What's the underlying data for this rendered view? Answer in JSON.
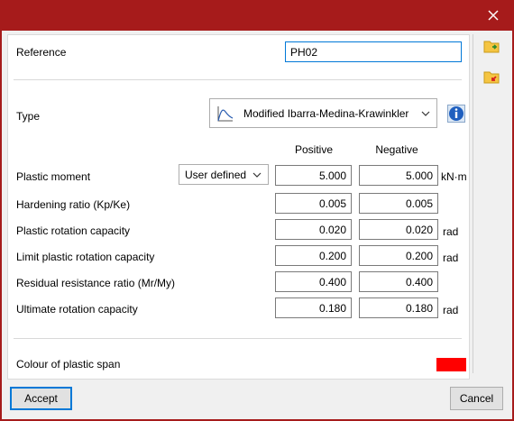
{
  "colors": {
    "titlebar": "#a61b1b",
    "accent": "#0078d7",
    "plastic_span_colour": "#ff0000"
  },
  "icons": {
    "close": "close-icon",
    "folder_open": "folder-open-icon",
    "folder_save": "folder-save-icon",
    "curve": "curve-icon",
    "info": "info-icon",
    "chevron": "chevron-down-icon"
  },
  "reference": {
    "label": "Reference",
    "value": "PH02"
  },
  "type": {
    "label": "Type",
    "selected": "Modified Ibarra-Medina-Krawinkler"
  },
  "columns": {
    "positive": "Positive",
    "negative": "Negative"
  },
  "rows": [
    {
      "label": "Plastic moment",
      "mode": "User defined",
      "positive": "5.000",
      "negative": "5.000",
      "unit": "kN·m"
    },
    {
      "label": "Hardening ratio (Kp/Ke)",
      "positive": "0.005",
      "negative": "0.005",
      "unit": ""
    },
    {
      "label": "Plastic rotation capacity",
      "positive": "0.020",
      "negative": "0.020",
      "unit": "rad"
    },
    {
      "label": "Limit plastic rotation capacity",
      "positive": "0.200",
      "negative": "0.200",
      "unit": "rad"
    },
    {
      "label": "Residual resistance ratio (Mr/My)",
      "positive": "0.400",
      "negative": "0.400",
      "unit": ""
    },
    {
      "label": "Ultimate rotation capacity",
      "positive": "0.180",
      "negative": "0.180",
      "unit": "rad"
    }
  ],
  "colour": {
    "label": "Colour of plastic span"
  },
  "buttons": {
    "accept": "Accept",
    "cancel": "Cancel"
  }
}
